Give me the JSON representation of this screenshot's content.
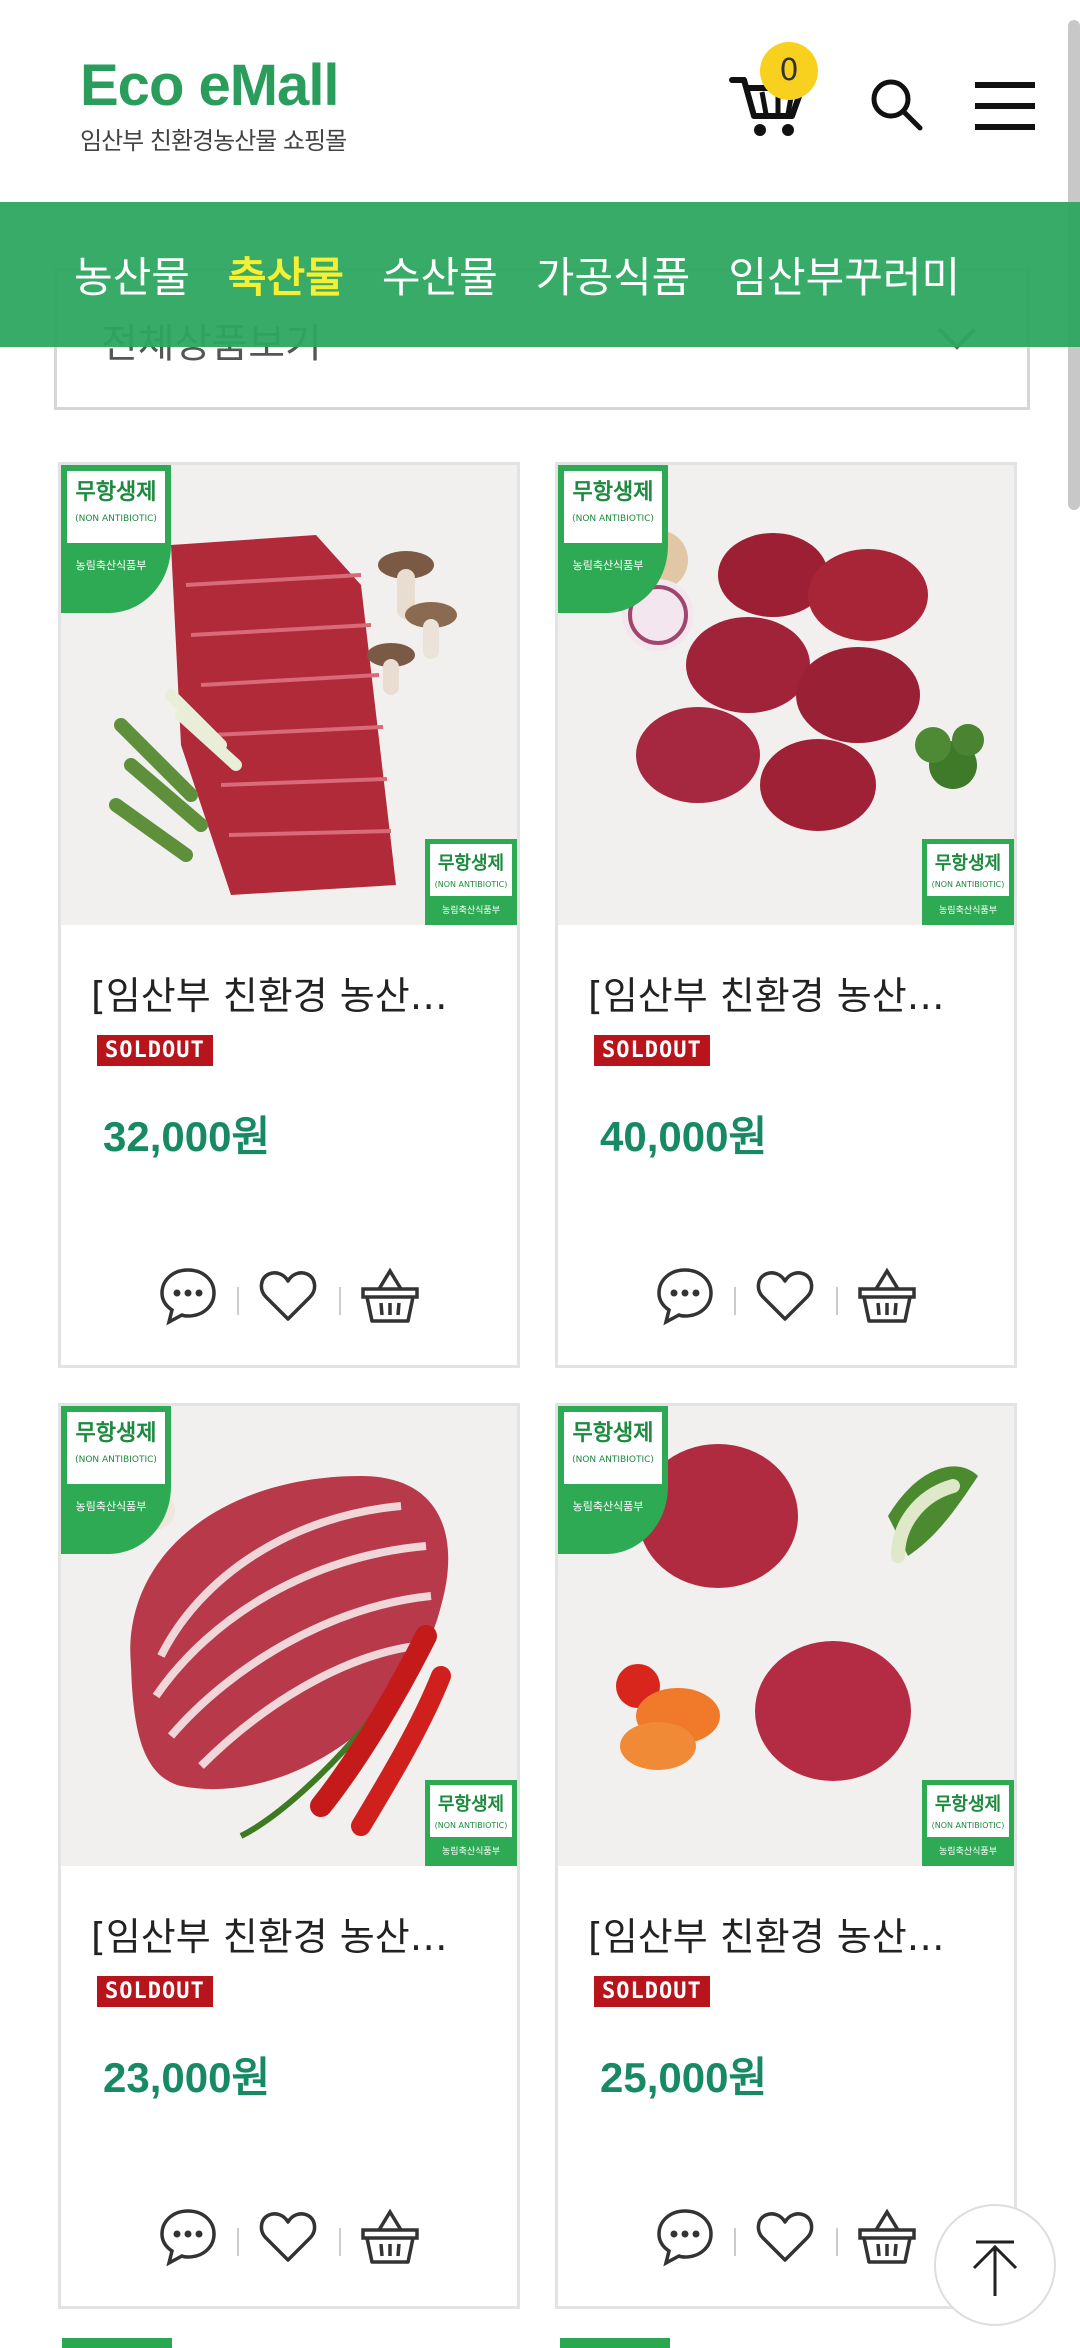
{
  "header": {
    "logo_main": "Eco eMall",
    "logo_sub": "임산부 친환경농산물 쇼핑몰",
    "cart_count": "0"
  },
  "nav": {
    "categories": [
      "농산물",
      "축산물",
      "수산물",
      "가공식품",
      "임산부꾸러미"
    ],
    "active_index": 1
  },
  "filter": {
    "selected": "전체상품보기"
  },
  "badge": {
    "top_line1": "무항생제",
    "top_line2": "(NON ANTIBIOTIC)",
    "top_line3": "농림축산식품부"
  },
  "products": [
    {
      "title": "[임산부 친환경 농산…",
      "status": "SOLDOUT",
      "price": "32,000원"
    },
    {
      "title": "[임산부 친환경 농산…",
      "status": "SOLDOUT",
      "price": "40,000원"
    },
    {
      "title": "[임산부 친환경 농산…",
      "status": "SOLDOUT",
      "price": "23,000원"
    },
    {
      "title": "[임산부 친환경 농산…",
      "status": "SOLDOUT",
      "price": "25,000원"
    }
  ],
  "colors": {
    "brand_green": "#2aa84f",
    "nav_active": "#f7f032",
    "price": "#188a63",
    "soldout": "#b8141c",
    "cart_badge": "#f7d11e"
  }
}
